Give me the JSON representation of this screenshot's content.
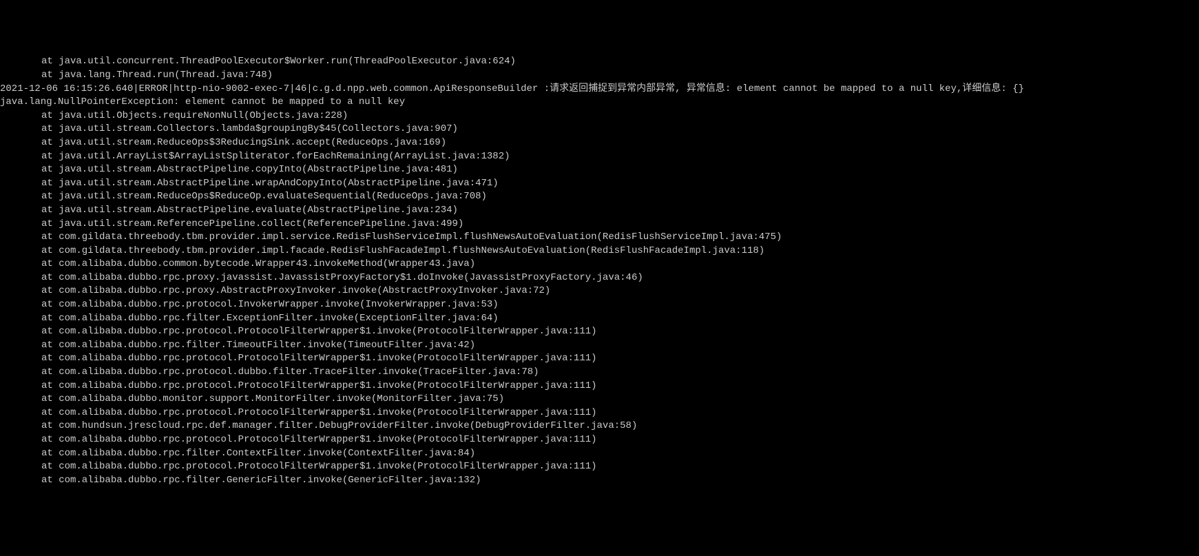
{
  "lines": [
    {
      "indent": true,
      "text": "at java.util.concurrent.ThreadPoolExecutor$Worker.run(ThreadPoolExecutor.java:624)"
    },
    {
      "indent": true,
      "text": "at java.lang.Thread.run(Thread.java:748)"
    },
    {
      "indent": false,
      "text": "2021-12-06 16:15:26.640|ERROR|http-nio-9002-exec-7|46|c.g.d.npp.web.common.ApiResponseBuilder :请求返回捕捉到异常内部异常, 异常信息: element cannot be mapped to a null key,详细信息: {}"
    },
    {
      "indent": false,
      "text": "java.lang.NullPointerException: element cannot be mapped to a null key"
    },
    {
      "indent": true,
      "text": "at java.util.Objects.requireNonNull(Objects.java:228)"
    },
    {
      "indent": true,
      "text": "at java.util.stream.Collectors.lambda$groupingBy$45(Collectors.java:907)"
    },
    {
      "indent": true,
      "text": "at java.util.stream.ReduceOps$3ReducingSink.accept(ReduceOps.java:169)"
    },
    {
      "indent": true,
      "text": "at java.util.ArrayList$ArrayListSpliterator.forEachRemaining(ArrayList.java:1382)"
    },
    {
      "indent": true,
      "text": "at java.util.stream.AbstractPipeline.copyInto(AbstractPipeline.java:481)"
    },
    {
      "indent": true,
      "text": "at java.util.stream.AbstractPipeline.wrapAndCopyInto(AbstractPipeline.java:471)"
    },
    {
      "indent": true,
      "text": "at java.util.stream.ReduceOps$ReduceOp.evaluateSequential(ReduceOps.java:708)"
    },
    {
      "indent": true,
      "text": "at java.util.stream.AbstractPipeline.evaluate(AbstractPipeline.java:234)"
    },
    {
      "indent": true,
      "text": "at java.util.stream.ReferencePipeline.collect(ReferencePipeline.java:499)"
    },
    {
      "indent": true,
      "text": "at com.gildata.threebody.tbm.provider.impl.service.RedisFlushServiceImpl.flushNewsAutoEvaluation(RedisFlushServiceImpl.java:475)"
    },
    {
      "indent": true,
      "text": "at com.gildata.threebody.tbm.provider.impl.facade.RedisFlushFacadeImpl.flushNewsAutoEvaluation(RedisFlushFacadeImpl.java:118)"
    },
    {
      "indent": true,
      "text": "at com.alibaba.dubbo.common.bytecode.Wrapper43.invokeMethod(Wrapper43.java)"
    },
    {
      "indent": true,
      "text": "at com.alibaba.dubbo.rpc.proxy.javassist.JavassistProxyFactory$1.doInvoke(JavassistProxyFactory.java:46)"
    },
    {
      "indent": true,
      "text": "at com.alibaba.dubbo.rpc.proxy.AbstractProxyInvoker.invoke(AbstractProxyInvoker.java:72)"
    },
    {
      "indent": true,
      "text": "at com.alibaba.dubbo.rpc.protocol.InvokerWrapper.invoke(InvokerWrapper.java:53)"
    },
    {
      "indent": true,
      "text": "at com.alibaba.dubbo.rpc.filter.ExceptionFilter.invoke(ExceptionFilter.java:64)"
    },
    {
      "indent": true,
      "text": "at com.alibaba.dubbo.rpc.protocol.ProtocolFilterWrapper$1.invoke(ProtocolFilterWrapper.java:111)"
    },
    {
      "indent": true,
      "text": "at com.alibaba.dubbo.rpc.filter.TimeoutFilter.invoke(TimeoutFilter.java:42)"
    },
    {
      "indent": true,
      "text": "at com.alibaba.dubbo.rpc.protocol.ProtocolFilterWrapper$1.invoke(ProtocolFilterWrapper.java:111)"
    },
    {
      "indent": true,
      "text": "at com.alibaba.dubbo.rpc.protocol.dubbo.filter.TraceFilter.invoke(TraceFilter.java:78)"
    },
    {
      "indent": true,
      "text": "at com.alibaba.dubbo.rpc.protocol.ProtocolFilterWrapper$1.invoke(ProtocolFilterWrapper.java:111)"
    },
    {
      "indent": true,
      "text": "at com.alibaba.dubbo.monitor.support.MonitorFilter.invoke(MonitorFilter.java:75)"
    },
    {
      "indent": true,
      "text": "at com.alibaba.dubbo.rpc.protocol.ProtocolFilterWrapper$1.invoke(ProtocolFilterWrapper.java:111)"
    },
    {
      "indent": true,
      "text": "at com.hundsun.jrescloud.rpc.def.manager.filter.DebugProviderFilter.invoke(DebugProviderFilter.java:58)"
    },
    {
      "indent": true,
      "text": "at com.alibaba.dubbo.rpc.protocol.ProtocolFilterWrapper$1.invoke(ProtocolFilterWrapper.java:111)"
    },
    {
      "indent": true,
      "text": "at com.alibaba.dubbo.rpc.filter.ContextFilter.invoke(ContextFilter.java:84)"
    },
    {
      "indent": true,
      "text": "at com.alibaba.dubbo.rpc.protocol.ProtocolFilterWrapper$1.invoke(ProtocolFilterWrapper.java:111)"
    },
    {
      "indent": true,
      "text": "at com.alibaba.dubbo.rpc.filter.GenericFilter.invoke(GenericFilter.java:132)"
    }
  ]
}
